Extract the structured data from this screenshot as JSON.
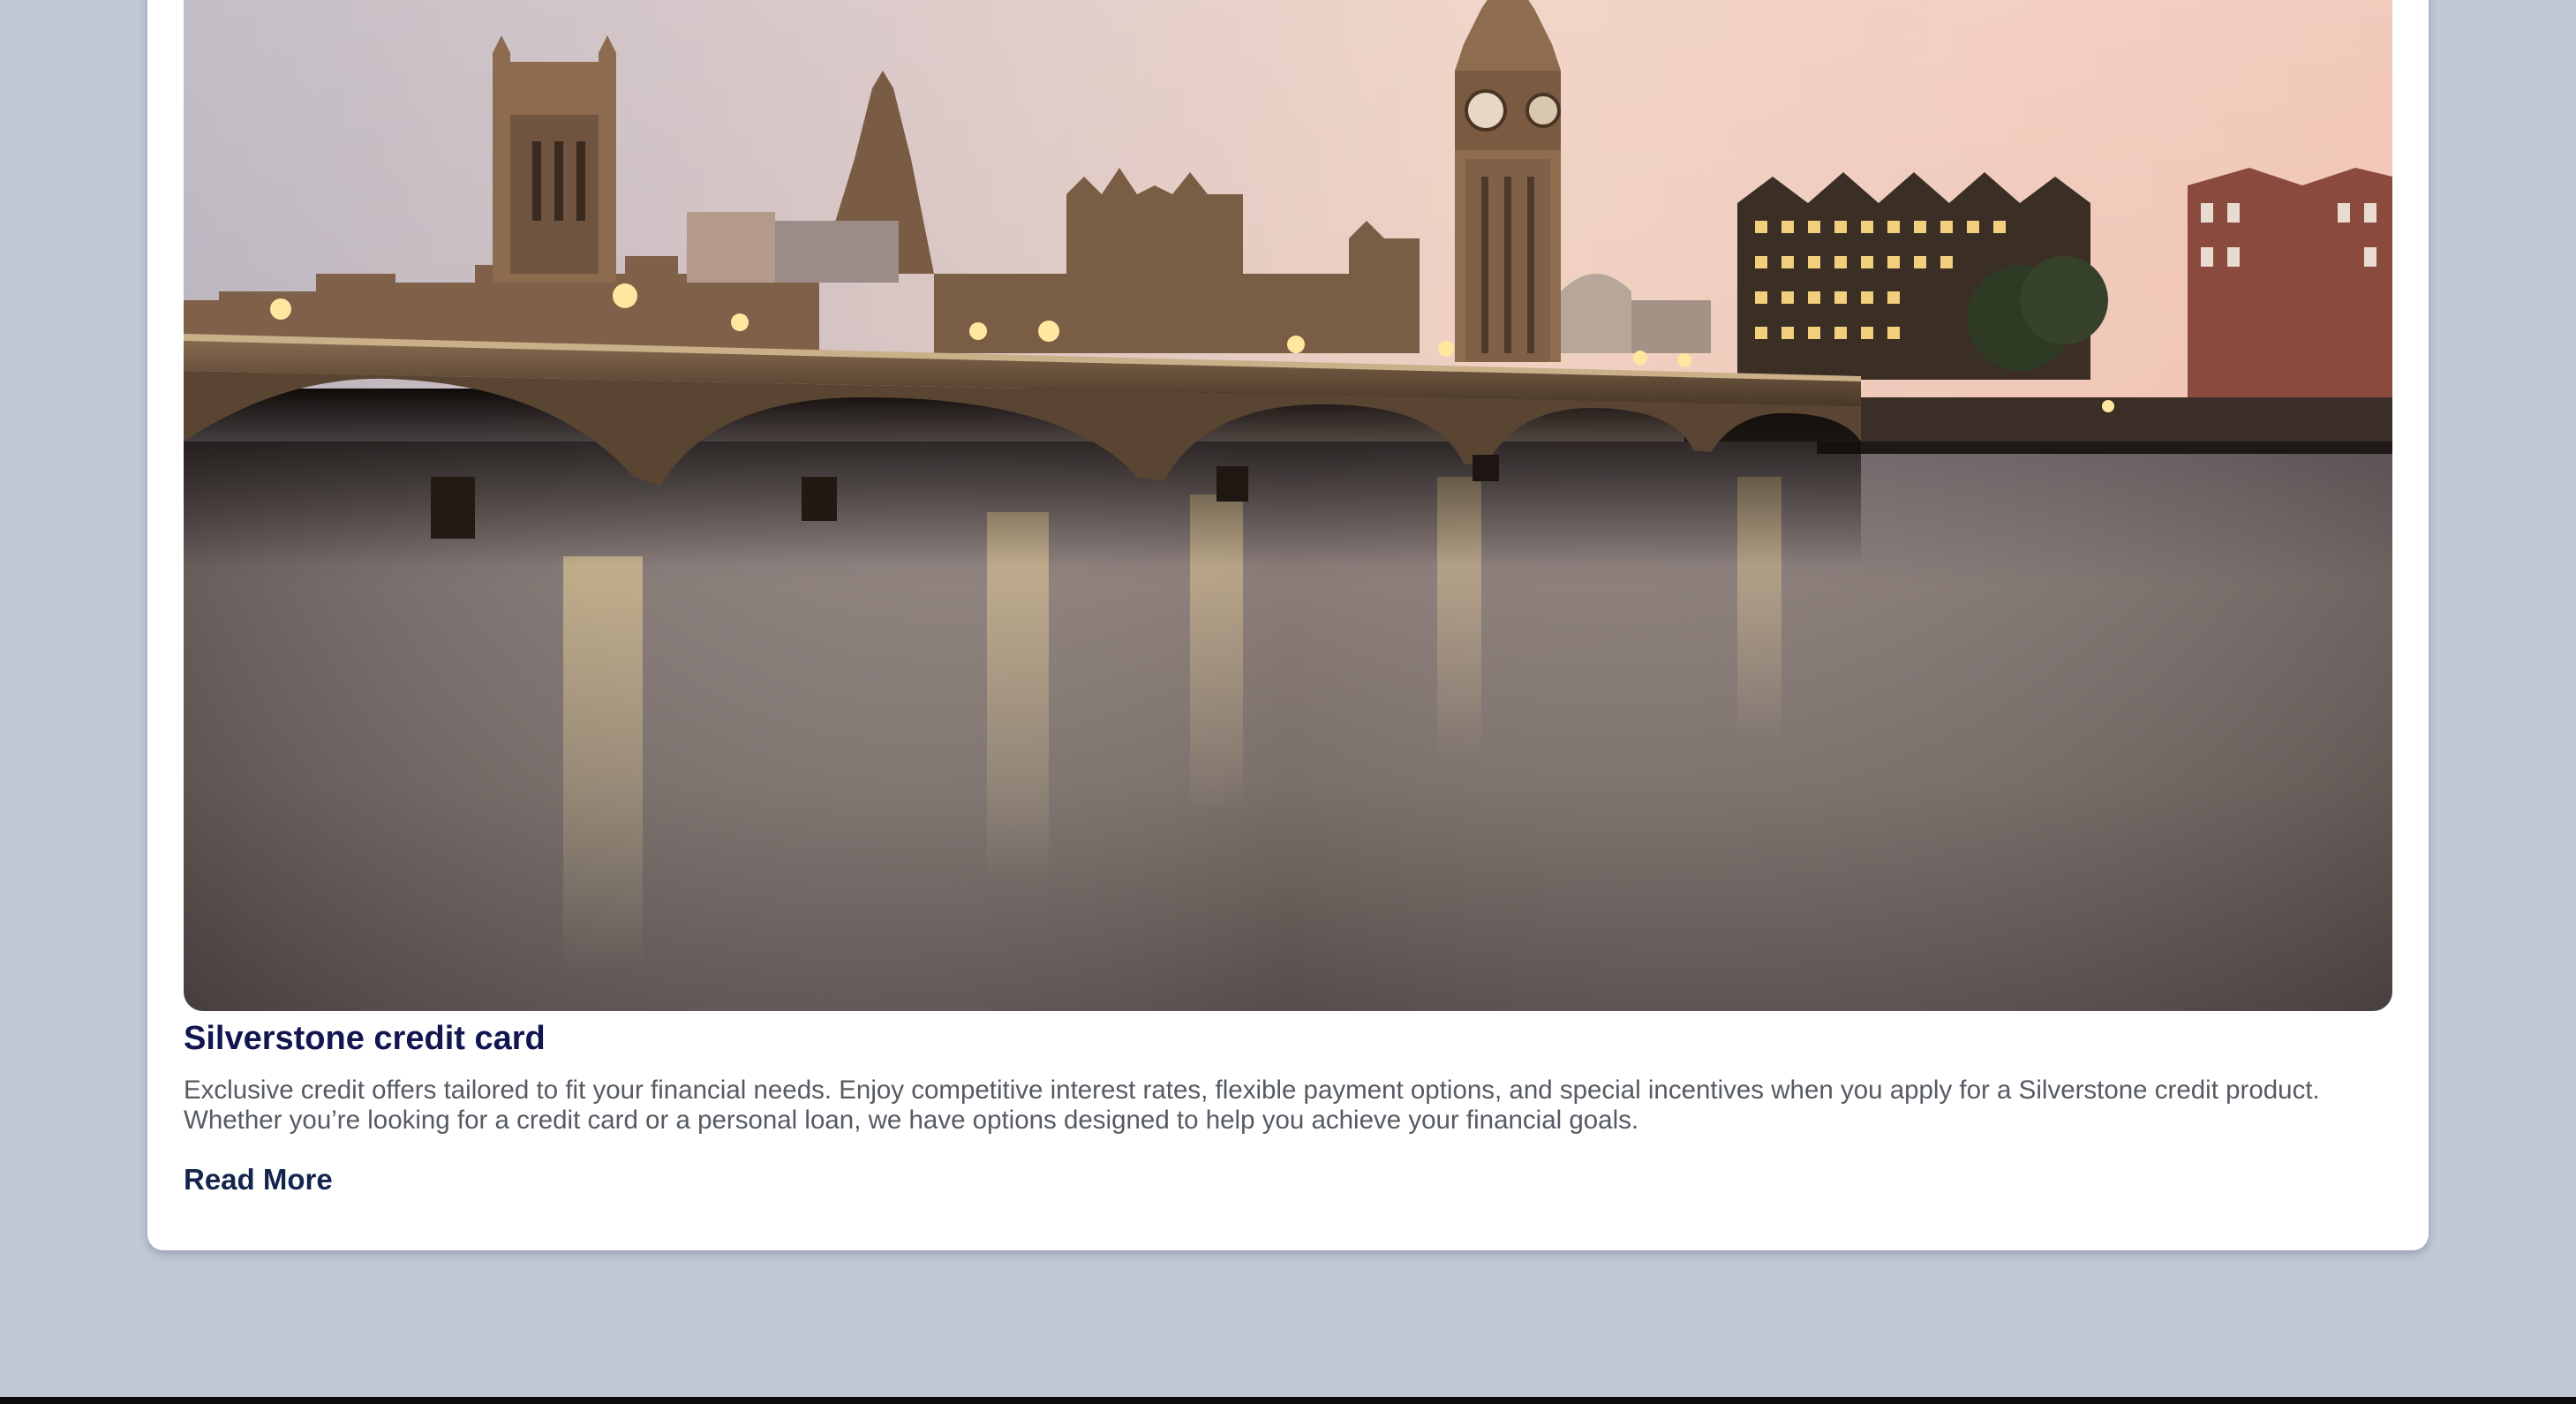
{
  "card": {
    "image_alt": "Westminster Bridge and the Houses of Parliament at dusk",
    "title": "Silverstone credit card",
    "description": "Exclusive credit offers tailored to fit your financial needs. Enjoy competitive interest rates, flexible payment options, and special incentives when you apply for a Silverstone credit product. Whether you’re looking for a credit card or a personal loan, we have options designed to help you achieve your financial goals.",
    "read_more_label": "Read More"
  },
  "colors": {
    "page_background": "#c2c8d6",
    "card_background": "#ffffff",
    "title": "#121650",
    "description": "#555a63",
    "link": "#14254d",
    "footer_bar": "#0b0b0d"
  }
}
